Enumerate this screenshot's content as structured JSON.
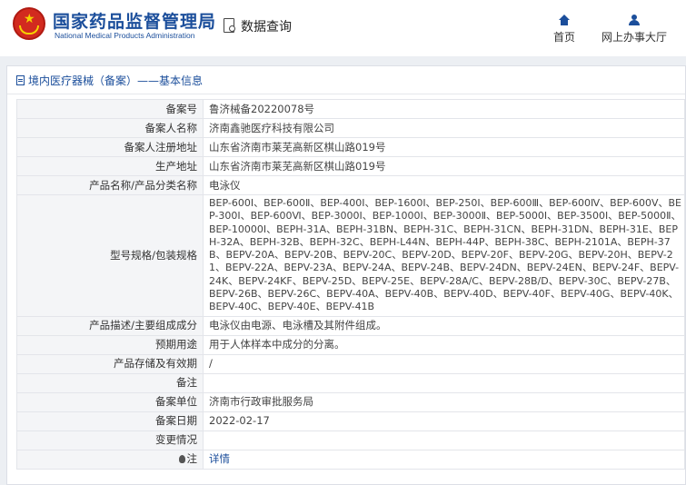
{
  "header": {
    "brand_cn": "国家药品监督管理局",
    "brand_en": "National Medical Products Administration",
    "query_label": "数据查询",
    "nav": [
      {
        "label": "首页",
        "icon": "home-icon"
      },
      {
        "label": "网上办事大厅",
        "icon": "user-icon"
      }
    ],
    "accent": "#1b4e9b"
  },
  "breadcrumb": "境内医疗器械（备案）——基本信息",
  "rows": [
    {
      "label": "备案号",
      "value": "鲁济械备20220078号"
    },
    {
      "label": "备案人名称",
      "value": "济南鑫驰医疗科技有限公司"
    },
    {
      "label": "备案人注册地址",
      "value": "山东省济南市莱芜高新区棋山路019号"
    },
    {
      "label": "生产地址",
      "value": "山东省济南市莱芜高新区棋山路019号"
    },
    {
      "label": "产品名称/产品分类名称",
      "value": "电泳仪"
    },
    {
      "label": "型号规格/包装规格",
      "value": "BEP-600Ⅰ、BEP-600Ⅱ、BEP-400Ⅰ、BEP-1600Ⅰ、BEP-250Ⅰ、BEP-600Ⅲ、BEP-600Ⅳ、BEP-600Ⅴ、BEP-300Ⅰ、BEP-600Ⅵ、BEP-3000Ⅰ、BEP-1000Ⅰ、BEP-3000Ⅱ、BEP-5000Ⅰ、BEP-3500Ⅰ、BEP-5000Ⅱ、BEP-10000Ⅰ、BEPH-31A、BEPH-31BN、BEPH-31C、BEPH-31CN、BEPH-31DN、BEPH-31E、BEPH-32A、BEPH-32B、BEPH-32C、BEPH-L44N、BEPH-44P、BEPH-38C、BEPH-2101A、BEPH-37B、BEPV-20A、BEPV-20B、BEPV-20C、BEPV-20D、BEPV-20F、BEPV-20G、BEPV-20H、BEPV-21、BEPV-22A、BEPV-23A、BEPV-24A、BEPV-24B、BEPV-24DN、BEPV-24EN、BEPV-24F、BEPV-24K、BEPV-24KF、BEPV-25D、BEPV-25E、BEPV-28A/C、BEPV-28B/D、BEPV-30C、BEPV-27B、BEPV-26B、BEPV-26C、BEPV-40A、BEPV-40B、BEPV-40D、BEPV-40F、BEPV-40G、BEPV-40K、BEPV-40C、BEPV-40E、BEPV-41B"
    },
    {
      "label": "产品描述/主要组成成分",
      "value": "电泳仪由电源、电泳槽及其附件组成。"
    },
    {
      "label": "预期用途",
      "value": "用于人体样本中成分的分离。"
    },
    {
      "label": "产品存储及有效期",
      "value": "/"
    },
    {
      "label": "备注",
      "value": ""
    },
    {
      "label": "备案单位",
      "value": "济南市行政审批服务局"
    },
    {
      "label": "备案日期",
      "value": "2022-02-17"
    },
    {
      "label": "变更情况",
      "value": ""
    },
    {
      "label": "注",
      "value": "详情",
      "icon": "bulb-icon"
    }
  ]
}
